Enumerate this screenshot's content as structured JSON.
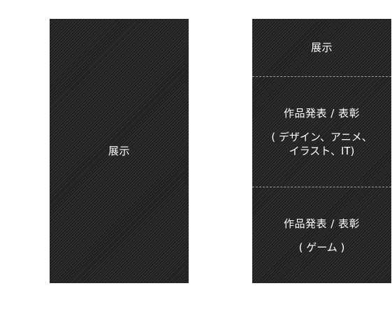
{
  "left_block": {
    "label": "展示"
  },
  "right_block": {
    "sections": [
      {
        "title": "展示"
      },
      {
        "title": "作品発表 / 表彰",
        "subtitle": "( デザイン、アニメ、\nイラスト、IT)"
      },
      {
        "title": "作品発表 / 表彰",
        "subtitle": "( ゲーム )"
      }
    ]
  },
  "colors": {
    "panel": "#1f1f1f",
    "text": "#ffffff",
    "divider": "#ffffff"
  }
}
